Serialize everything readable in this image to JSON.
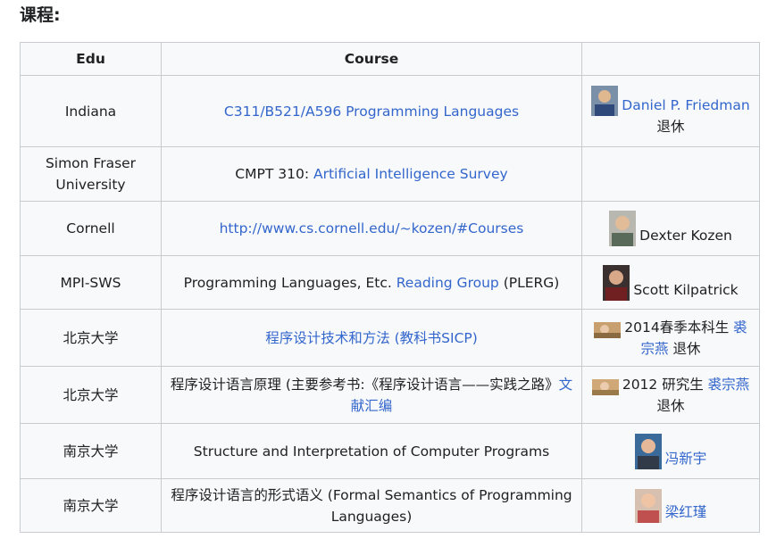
{
  "section": {
    "heading": "课程:"
  },
  "headers": {
    "edu": "Edu",
    "course": "Course",
    "teacher": ""
  },
  "colors": {
    "link": "#3366cc",
    "border": "#c8ccd1",
    "cell_bg": "#f8f9fa"
  },
  "rows": [
    {
      "edu": "Indiana",
      "course_link": "C311/B521/A596 Programming Languages",
      "teacher_link": "Daniel P. Friedman",
      "teacher_note": "退休"
    },
    {
      "edu": "Simon Fraser University",
      "course_prefix": "CMPT 310: ",
      "course_link": "Artificial Intelligence Survey"
    },
    {
      "edu": "Cornell",
      "course_link": "http://www.cs.cornell.edu/~kozen/#Courses",
      "teacher_name": "Dexter Kozen"
    },
    {
      "edu": "MPI-SWS",
      "course_prefix": "Programming Languages, Etc. ",
      "course_link": "Reading Group",
      "course_suffix": " (PLERG)",
      "teacher_name": "Scott Kilpatrick"
    },
    {
      "edu": "北京大学",
      "course_link": "程序设计技术和方法 (教科书SICP)",
      "teacher_prefix": "2014春季本科生 ",
      "teacher_link": "裘宗燕",
      "teacher_note": " 退休"
    },
    {
      "edu": "北京大学",
      "course_prefix": "程序设计语言原理 (主要参考书:《程序设计语言——实践之路》",
      "course_link": "文献汇编",
      "teacher_prefix": "2012 研究生 ",
      "teacher_link": "裘宗燕",
      "teacher_note": " 退休"
    },
    {
      "edu": "南京大学",
      "course_text": "Structure and Interpretation of Computer Programs",
      "teacher_link": "冯新宇"
    },
    {
      "edu": "南京大学",
      "course_text": "程序设计语言的形式语义 (Formal Semantics of Programming Languages)",
      "teacher_link": "梁红瑾"
    }
  ],
  "icons": [
    "portrait-photo-icon"
  ]
}
